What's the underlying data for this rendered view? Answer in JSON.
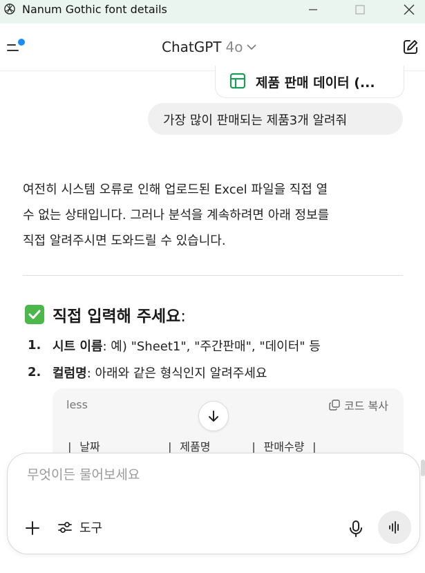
{
  "window": {
    "title": "Nanum Gothic font details",
    "controls": {
      "minimize": "minimize-icon",
      "maximize": "maximize-icon",
      "close": "close-icon"
    }
  },
  "header": {
    "model_name": "ChatGPT",
    "model_version": "4o"
  },
  "attachment": {
    "icon": "spreadsheet-icon",
    "name": "제품 판매 데이터 (..."
  },
  "user_message": "가장 많이 판매되는 제품3개 알려줘",
  "assistant": {
    "paragraph_lines": [
      "여전히 시스템 오류로 인해 업로드된 Excel 파일을 직접 열",
      "수 없는 상태입니다. 그러나 분석을 계속하려면 아래 정보를",
      "직접 알려주시면 도와드릴 수 있습니다."
    ],
    "section_title": "직접 입력해 주세요",
    "section_title_colon": ":",
    "list": [
      {
        "number": "1.",
        "key": "시트 이름",
        "rest": ": 예) \"Sheet1\", \"주간판매\", \"데이터\" 등"
      },
      {
        "number": "2.",
        "key": "컬럼명",
        "rest": ": 아래와 같은 형식인지 알려주세요"
      }
    ],
    "code_block": {
      "language": "less",
      "copy_label": "코드 복사",
      "line": "| 날짜          | 제품명      | 판매수량 |"
    }
  },
  "composer": {
    "placeholder": "무엇이든 물어보세요",
    "value": "",
    "tools_label": "도구"
  },
  "colors": {
    "accent_dot": "#1a8cff",
    "check_green": "#4cb84c",
    "sheet_icon_green": "#1a9b57",
    "titlebar_bg": "#eaf5ef"
  }
}
